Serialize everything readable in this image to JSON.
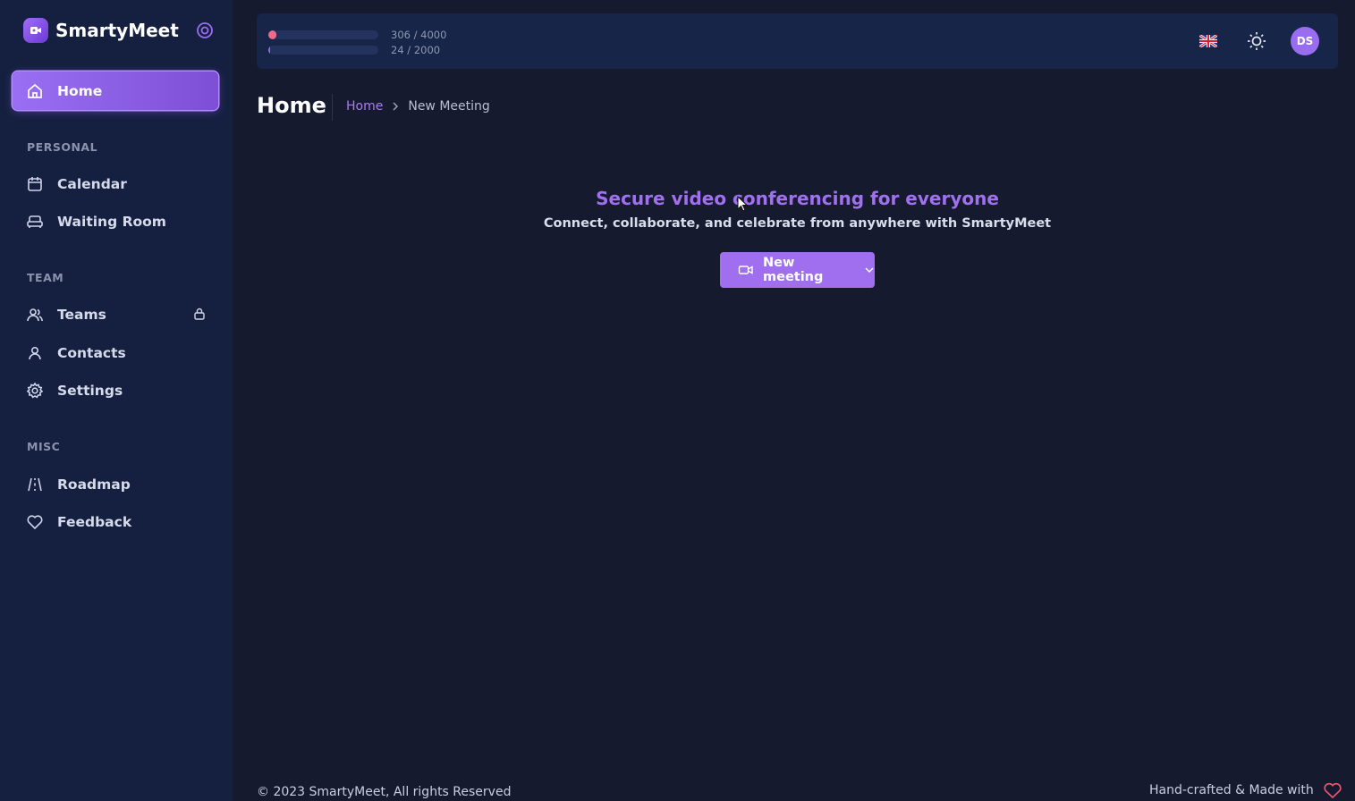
{
  "app": {
    "name": "SmartyMeet"
  },
  "sidebar": {
    "home_label": "Home",
    "sections": {
      "personal": "PERSONAL",
      "team": "TEAM",
      "misc": "MISC"
    },
    "items": {
      "calendar": "Calendar",
      "waiting_room": "Waiting Room",
      "teams": "Teams",
      "contacts": "Contacts",
      "settings": "Settings",
      "roadmap": "Roadmap",
      "feedback": "Feedback"
    }
  },
  "topbar": {
    "usage": [
      {
        "text": "306 / 4000",
        "fraction": 0.0765,
        "color": "#ef6b8c"
      },
      {
        "text": "24 / 2000",
        "fraction": 0.012,
        "color": "#8f6ff0"
      }
    ],
    "avatar_initials": "DS",
    "icons": [
      "uk-flag-icon",
      "sun-icon"
    ]
  },
  "header": {
    "title": "Home",
    "breadcrumb": {
      "link": "Home",
      "current": "New Meeting"
    }
  },
  "hero": {
    "title": "Secure video conferencing for everyone",
    "subtitle": "Connect, collaborate, and celebrate from anywhere with SmartyMeet",
    "button_label": "New meeting"
  },
  "footer": {
    "copyright": "© 2023 SmartyMeet, All rights Reserved",
    "made_with": "Hand-crafted & Made with"
  },
  "colors": {
    "accent": "#9f6ff0",
    "background": "#161a2e",
    "sidebar": "#152040"
  }
}
